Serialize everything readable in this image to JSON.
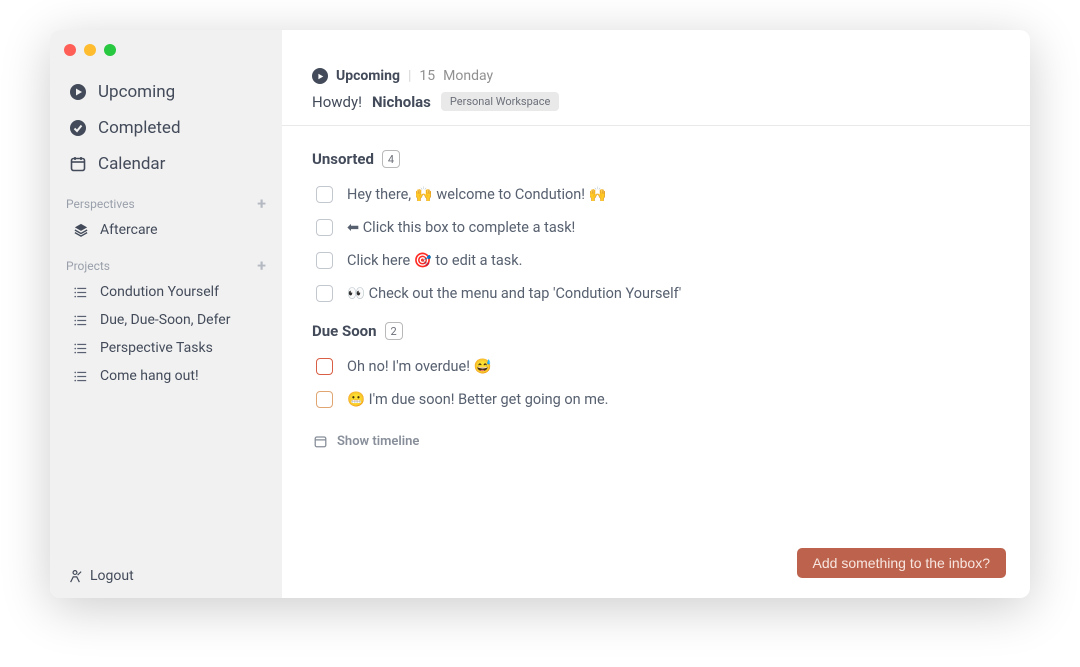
{
  "sidebar": {
    "nav": [
      {
        "label": "Upcoming",
        "icon": "play-circle"
      },
      {
        "label": "Completed",
        "icon": "check-circle"
      },
      {
        "label": "Calendar",
        "icon": "calendar"
      }
    ],
    "perspectives": {
      "title": "Perspectives",
      "items": [
        {
          "label": "Aftercare",
          "icon": "layers"
        }
      ]
    },
    "projects": {
      "title": "Projects",
      "items": [
        {
          "label": "Condution Yourself"
        },
        {
          "label": "Due, Due-Soon, Defer"
        },
        {
          "label": "Perspective Tasks"
        },
        {
          "label": "Come hang out!"
        }
      ]
    },
    "logout": "Logout"
  },
  "header": {
    "breadcrumb_title": "Upcoming",
    "date_num": "15",
    "date_day": "Monday",
    "greeting": "Howdy!",
    "name": "Nicholas",
    "workspace": "Personal Workspace"
  },
  "groups": [
    {
      "title": "Unsorted",
      "count": "4",
      "tasks": [
        {
          "text": "Hey there, 🙌 welcome to Condution! 🙌",
          "state": "normal"
        },
        {
          "text": "⬅ Click this box to complete a task!",
          "state": "normal"
        },
        {
          "text": "Click here 🎯 to edit a task.",
          "state": "normal"
        },
        {
          "text": "👀 Check out the menu and tap 'Condution Yourself'",
          "state": "normal"
        }
      ]
    },
    {
      "title": "Due Soon",
      "count": "2",
      "tasks": [
        {
          "text": "Oh no! I'm overdue! 😅",
          "state": "overdue"
        },
        {
          "text": "😬 I'm due soon! Better get going on me.",
          "state": "duesoon"
        }
      ]
    }
  ],
  "timeline_label": "Show timeline",
  "inbox_placeholder": "Add something to the inbox?"
}
